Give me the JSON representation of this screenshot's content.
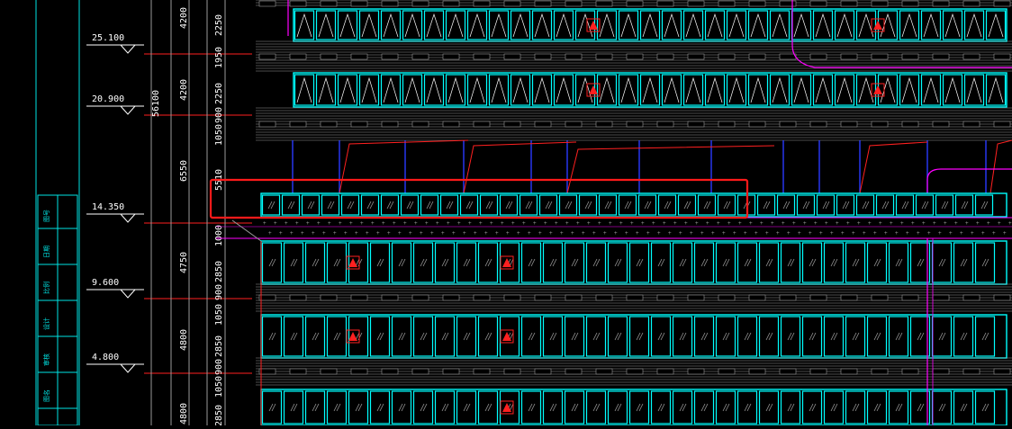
{
  "elevations": [
    "25.100",
    "20.900",
    "14.350",
    "9.600",
    "4.800"
  ],
  "dimensions_col1": [
    "4200",
    "4200",
    "6550",
    "4750",
    "4800",
    "4800"
  ],
  "dimensions_col2": [
    "2250",
    "1950",
    "2250",
    "900",
    "1050",
    "5510",
    "1000",
    "2850",
    "900",
    "1050",
    "2850",
    "900",
    "1050",
    "2850"
  ],
  "overall_dimension": "56100",
  "title_block_labels": [
    "图号",
    "日期",
    "比例",
    "设计",
    "审核",
    "图名"
  ],
  "colors": {
    "background": "#000000",
    "frame": "#00e5e5",
    "panel": "#00ffff",
    "gray": "#9a9a9a",
    "red": "#ff2020",
    "magenta": "#ff00ff",
    "blue": "#2a3aff",
    "white": "#ffffff",
    "highlight": "#ff1a1a"
  }
}
